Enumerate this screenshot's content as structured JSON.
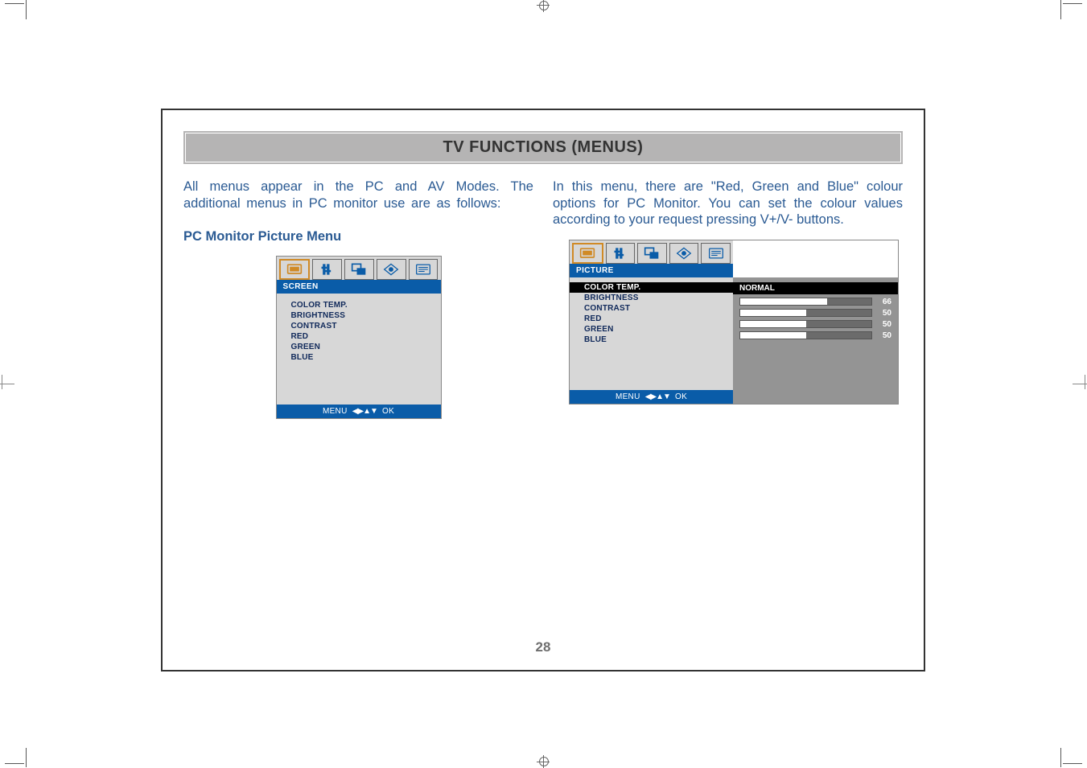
{
  "header": {
    "title": "TV FUNCTIONS (MENUS)"
  },
  "left_col": {
    "intro": "All menus appear in the PC and AV Modes. The additional menus in PC monitor use are as follows:",
    "subhead": "PC Monitor Picture Menu",
    "osd_small": {
      "category": "SCREEN",
      "items": [
        "COLOR TEMP.",
        "BRIGHTNESS",
        "CONTRAST",
        "RED",
        "GREEN",
        "BLUE"
      ],
      "footer_left": "MENU",
      "footer_right": "OK"
    }
  },
  "right_col": {
    "intro": "In this menu, there are \"Red, Green and Blue\" colour options for PC Monitor. You can set the colour values according to your request pressing V+/V- buttons.",
    "osd_big": {
      "category": "PICTURE",
      "selected_item": "COLOR TEMP.",
      "selected_value": "NORMAL",
      "items": [
        {
          "label": "BRIGHTNESS",
          "value": 66
        },
        {
          "label": "CONTRAST",
          "value": 50
        },
        {
          "label": "RED",
          "value": 50
        },
        {
          "label": "GREEN",
          "value": 50
        },
        {
          "label": "BLUE"
        }
      ],
      "footer_left": "MENU",
      "footer_right": "OK"
    }
  },
  "page_number": "28",
  "icons": {
    "screen": "screen-icon",
    "sound": "sound-slider-icon",
    "pip": "overlap-windows-icon",
    "info": "diamond-info-icon",
    "teletext": "teletext-icon"
  }
}
